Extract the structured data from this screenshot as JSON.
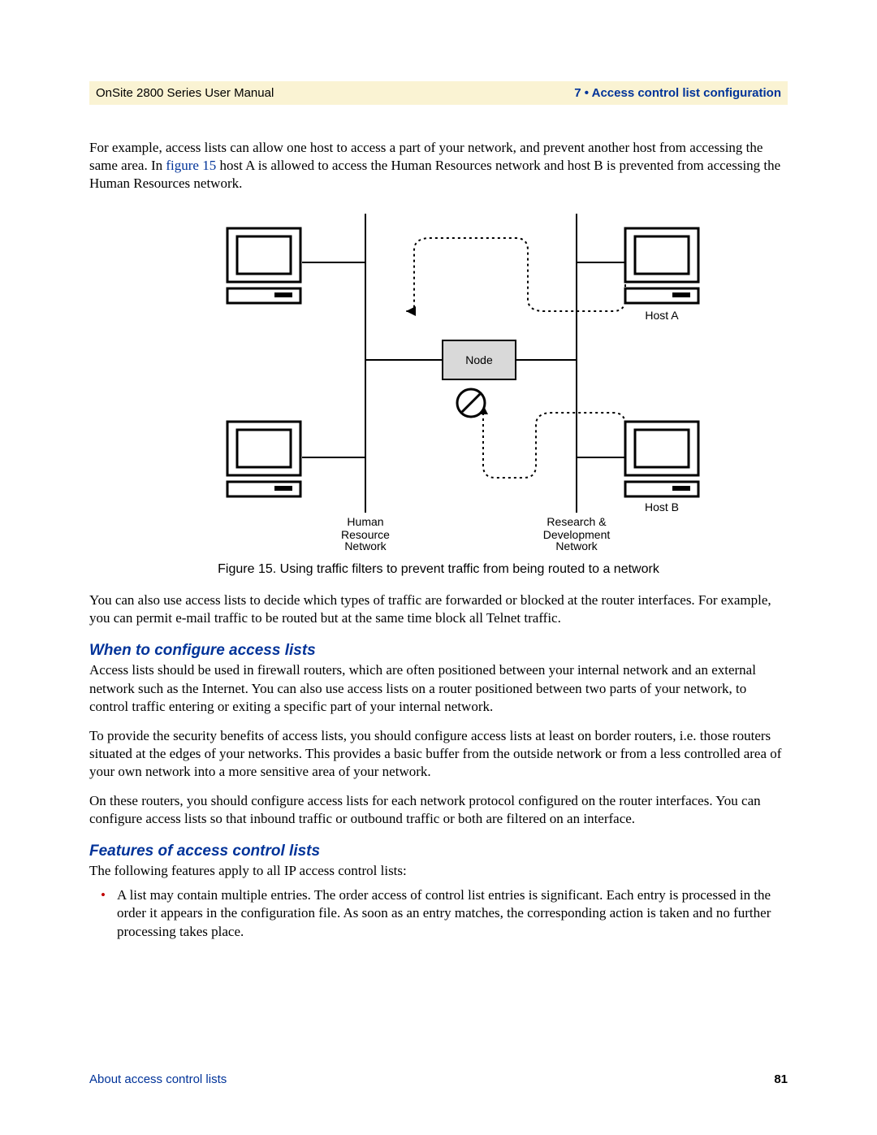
{
  "header": {
    "left": "OnSite 2800 Series User Manual",
    "right": "7 • Access control list configuration"
  },
  "para1_pre": "For example, access lists can allow one host to access a part of your network, and prevent another host from accessing the same area. In ",
  "para1_link": "figure 15",
  "para1_post": " host A is allowed to access the Human Resources network and host B is prevented from accessing the Human Resources network.",
  "diagram": {
    "node_label": "Node",
    "host_a": "Host A",
    "host_b": "Host B",
    "hr1": "Human",
    "hr2": "Resource",
    "hr3": "Network",
    "rd1": "Research &",
    "rd2": "Development",
    "rd3": "Network"
  },
  "figure_caption": "Figure 15. Using traffic filters to prevent traffic from being routed to a network",
  "para2": "You can also use access lists to decide which types of traffic are forwarded or blocked at the router interfaces. For example, you can permit e-mail traffic to be routed but at the same time block all Telnet traffic.",
  "heading1": "When to configure access lists",
  "para3": "Access lists should be used in firewall routers, which are often positioned between your internal network and an external network such as the Internet. You can also use access lists on a router positioned between two parts of your network, to control traffic entering or exiting a specific part of your internal network.",
  "para4": "To provide the security benefits of access lists, you should configure access lists at least on border routers, i.e. those routers situated at the edges of your networks. This provides a basic buffer from the outside network or from a less controlled area of your own network into a more sensitive area of your network.",
  "para5": "On these routers, you should configure access lists for each network protocol configured on the router interfaces. You can configure access lists so that inbound traffic or outbound traffic or both are filtered on an interface.",
  "heading2": "Features of access control lists",
  "para6": "The following features apply to all IP access control lists:",
  "bullet1": "A list may contain multiple entries. The order access of control list entries is significant. Each entry is processed in the order it appears in the configuration file. As soon as an entry matches, the corresponding action is taken and no further processing takes place.",
  "footer": {
    "left": "About access control lists",
    "right": "81"
  }
}
